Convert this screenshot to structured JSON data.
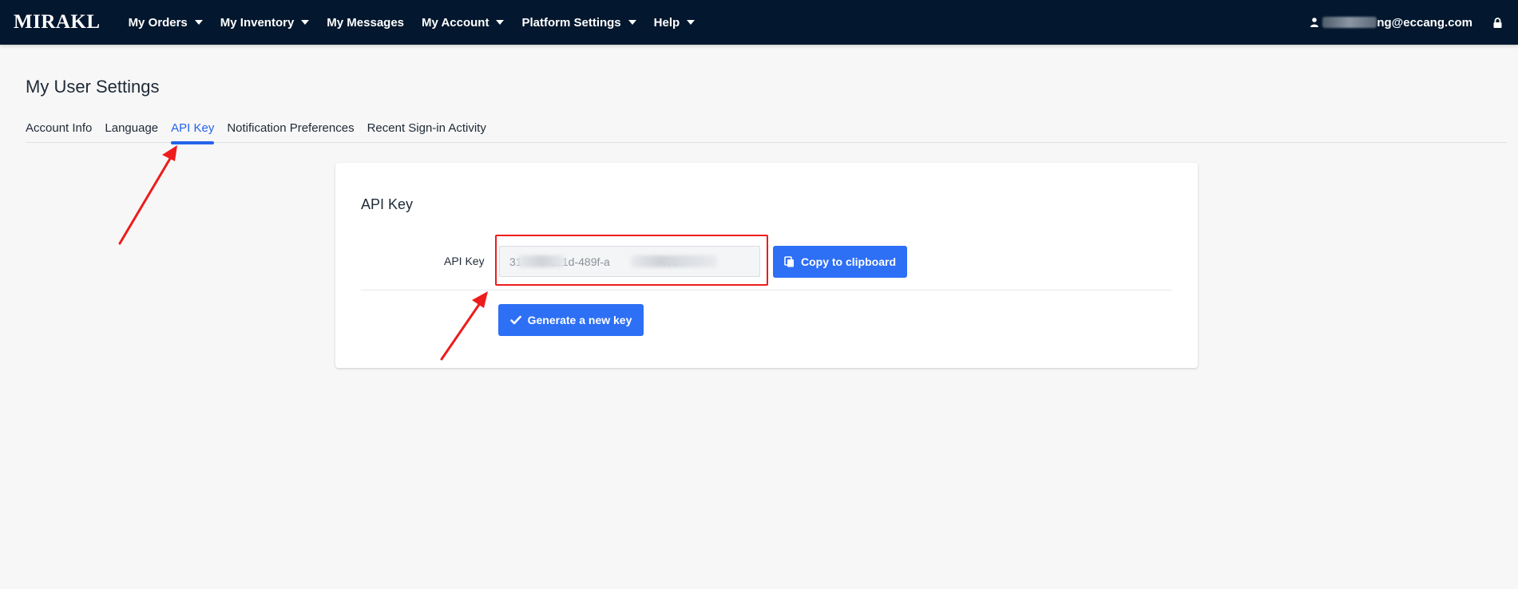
{
  "header": {
    "logo": "MIRAKL",
    "nav": [
      {
        "label": "My Orders",
        "dropdown": true
      },
      {
        "label": "My Inventory",
        "dropdown": true
      },
      {
        "label": "My Messages",
        "dropdown": false
      },
      {
        "label": "My Account",
        "dropdown": true
      },
      {
        "label": "Platform Settings",
        "dropdown": true
      },
      {
        "label": "Help",
        "dropdown": true
      }
    ],
    "user_email_visible": "ng@eccang.com",
    "icons": {
      "user": "user-icon",
      "lock": "lock-icon"
    }
  },
  "page": {
    "title": "My User Settings",
    "tabs": [
      {
        "label": "Account Info",
        "active": false
      },
      {
        "label": "Language",
        "active": false
      },
      {
        "label": "API Key",
        "active": true
      },
      {
        "label": "Notification Preferences",
        "active": false
      },
      {
        "label": "Recent Sign-in Activity",
        "active": false
      }
    ]
  },
  "card": {
    "title": "API Key",
    "field_label": "API Key",
    "api_key_visible": "31        -211d-489f-a                 f06",
    "copy_label": "Copy to clipboard",
    "generate_label": "Generate a new key"
  },
  "colors": {
    "nav_bg": "#03172e",
    "accent": "#2d6ff5",
    "tab_active": "#2563eb",
    "annotation": "#ee1c1c"
  }
}
